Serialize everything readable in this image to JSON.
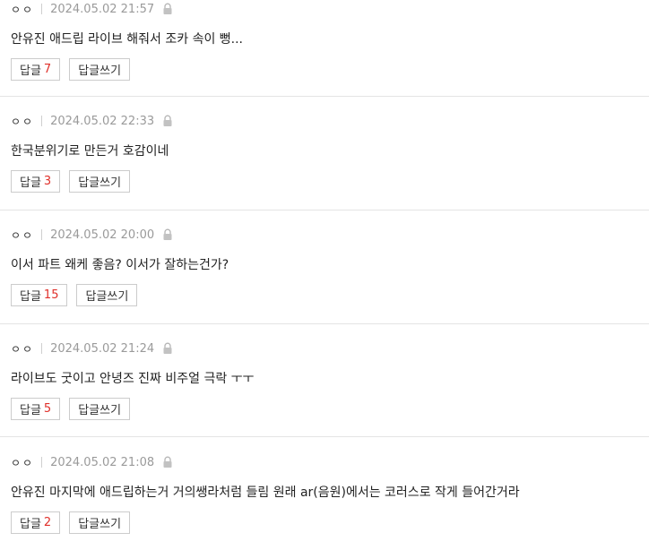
{
  "comments": [
    {
      "author": "ㅇㅇ",
      "date": "2024.05.02 21:57",
      "text": "안유진 애드립 라이브 해줘서 조카 속이 뻥...",
      "reply_label": "답글",
      "reply_count": "7",
      "write_reply_label": "답글쓰기"
    },
    {
      "author": "ㅇㅇ",
      "date": "2024.05.02 22:33",
      "text": "한국분위기로 만든거 호감이네",
      "reply_label": "답글",
      "reply_count": "3",
      "write_reply_label": "답글쓰기"
    },
    {
      "author": "ㅇㅇ",
      "date": "2024.05.02 20:00",
      "text": "이서 파트 왜케 좋음? 이서가 잘하는건가?",
      "reply_label": "답글",
      "reply_count": "15",
      "write_reply_label": "답글쓰기"
    },
    {
      "author": "ㅇㅇ",
      "date": "2024.05.02 21:24",
      "text": "라이브도 굿이고 안녕즈 진짜 비주얼 극락 ㅜㅜ",
      "reply_label": "답글",
      "reply_count": "5",
      "write_reply_label": "답글쓰기"
    },
    {
      "author": "ㅇㅇ",
      "date": "2024.05.02 21:08",
      "text": "안유진 마지막에 애드립하는거 거의쌩라처럼 들림 원래 ar(음원)에서는 코러스로 작게 들어간거라",
      "reply_label": "답글",
      "reply_count": "2",
      "write_reply_label": "답글쓰기"
    }
  ],
  "icons": {
    "lock": "lock-icon"
  },
  "colors": {
    "reply_count": "#e0302a",
    "divider": "#e4e4e4",
    "date": "#9a9a9a"
  }
}
